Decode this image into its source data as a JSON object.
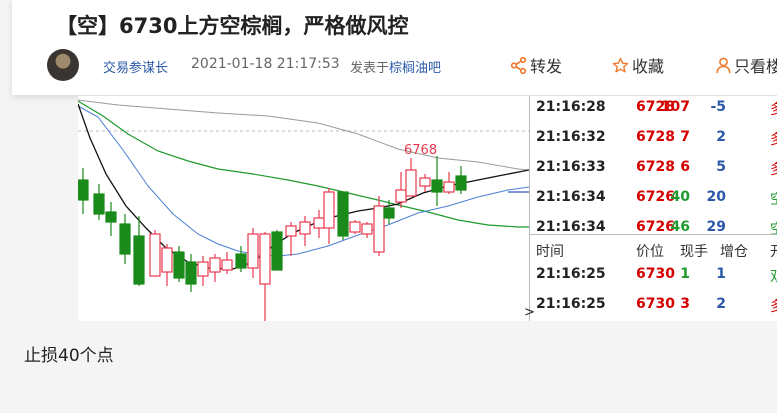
{
  "post": {
    "title": "【空】6730上方空棕榈，严格做风控",
    "author": "交易参谋长",
    "time": "2021-01-18 21:17:53",
    "published_in_label": "发表于",
    "forum": "棕榈油吧",
    "body": "止损40个点"
  },
  "actions": {
    "repost": "转发",
    "favorite": "收藏",
    "author_only": "只看楼主"
  },
  "chart": {
    "high_label": "6768",
    "colors": {
      "up": "#e8384d",
      "down": "#1a8a1a",
      "ma_black": "#111111",
      "ma_blue": "#4a7fd4",
      "ma_green": "#1f9a2e",
      "ma_gray": "#9a9a9a"
    }
  },
  "ticks_top": [
    {
      "time": "21:16:28",
      "price": "6728",
      "volume": "107",
      "oi_change": "-5",
      "type": "多"
    },
    {
      "time": "21:16:32",
      "price": "6728",
      "volume": "7",
      "oi_change": "2",
      "type": "多"
    },
    {
      "time": "21:16:33",
      "price": "6728",
      "volume": "6",
      "oi_change": "5",
      "type": "多"
    },
    {
      "time": "21:16:34",
      "price": "6726",
      "volume": "40",
      "oi_change": "20",
      "type": "空"
    },
    {
      "time": "21:16:34",
      "price": "6726",
      "volume": "46",
      "oi_change": "29",
      "type": "空"
    }
  ],
  "ticks_header": {
    "time": "时间",
    "price": "价位",
    "volume": "现手",
    "oi_change": "增仓",
    "type": "开"
  },
  "ticks_bottom": [
    {
      "time": "21:16:25",
      "price": "6730",
      "volume": "1",
      "oi_change": "1",
      "type": "双"
    },
    {
      "time": "21:16:25",
      "price": "6730",
      "volume": "3",
      "oi_change": "2",
      "type": "多"
    }
  ]
}
